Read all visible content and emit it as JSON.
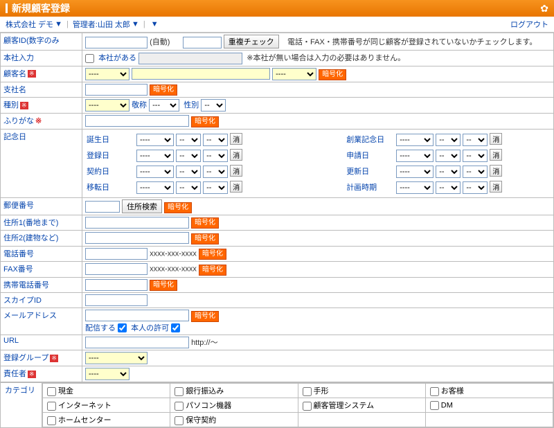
{
  "header": {
    "title": "新規顧客登録"
  },
  "subhead": {
    "company_label": "株式会社",
    "company": "デモ",
    "admin_label": "管理者:",
    "admin": "山田 太郎",
    "logout": "ログアウト"
  },
  "labels": {
    "customer_id": "顧客ID(数字のみ",
    "hq_input": "本社入力",
    "customer_name": "顧客名",
    "branch_name": "支社名",
    "type": "種別",
    "furigana": "ふりがな",
    "anniversary": "記念日",
    "postal": "郵便番号",
    "addr1": "住所1(番地まで)",
    "addr2": "住所2(建物など)",
    "tel": "電話番号",
    "fax": "FAX番号",
    "mobile": "携帯電話番号",
    "skype": "スカイプID",
    "email": "メールアドレス",
    "url": "URL",
    "group": "登録グループ",
    "owner": "責任者",
    "category": "カテゴリ"
  },
  "required_mark": "※",
  "auto_label": "(自動)",
  "dup_check": "重複チェック",
  "dup_note": "電話・FAX・携帯番号が同じ顧客が登録されていないかチェックします。",
  "hq_checkbox": "本社がある",
  "hq_note": "※本社が無い場合は入力の必要はありません。",
  "dash": "----",
  "tag": "暗号化",
  "type_honorific_label": "敬称",
  "type_gender_label": "性別",
  "dates": {
    "left": [
      {
        "label": "誕生日"
      },
      {
        "label": "登録日"
      },
      {
        "label": "契約日"
      },
      {
        "label": "移転日"
      }
    ],
    "right": [
      {
        "label": "創業記念日"
      },
      {
        "label": "申請日"
      },
      {
        "label": "更新日"
      },
      {
        "label": "計画時期"
      }
    ],
    "clear": "消"
  },
  "postal_search": "住所検索",
  "tel_ph": "xxxx-xxx-xxxx",
  "email_deliver": "配信する",
  "email_permission": "本人の許可",
  "url_ph": "http://～",
  "categories": [
    [
      "現金",
      "銀行振込み",
      "手形",
      "お客様"
    ],
    [
      "インターネット",
      "パソコン機器",
      "顧客管理システム",
      "DM"
    ],
    [
      "ホームセンター",
      "保守契約",
      "",
      ""
    ]
  ]
}
